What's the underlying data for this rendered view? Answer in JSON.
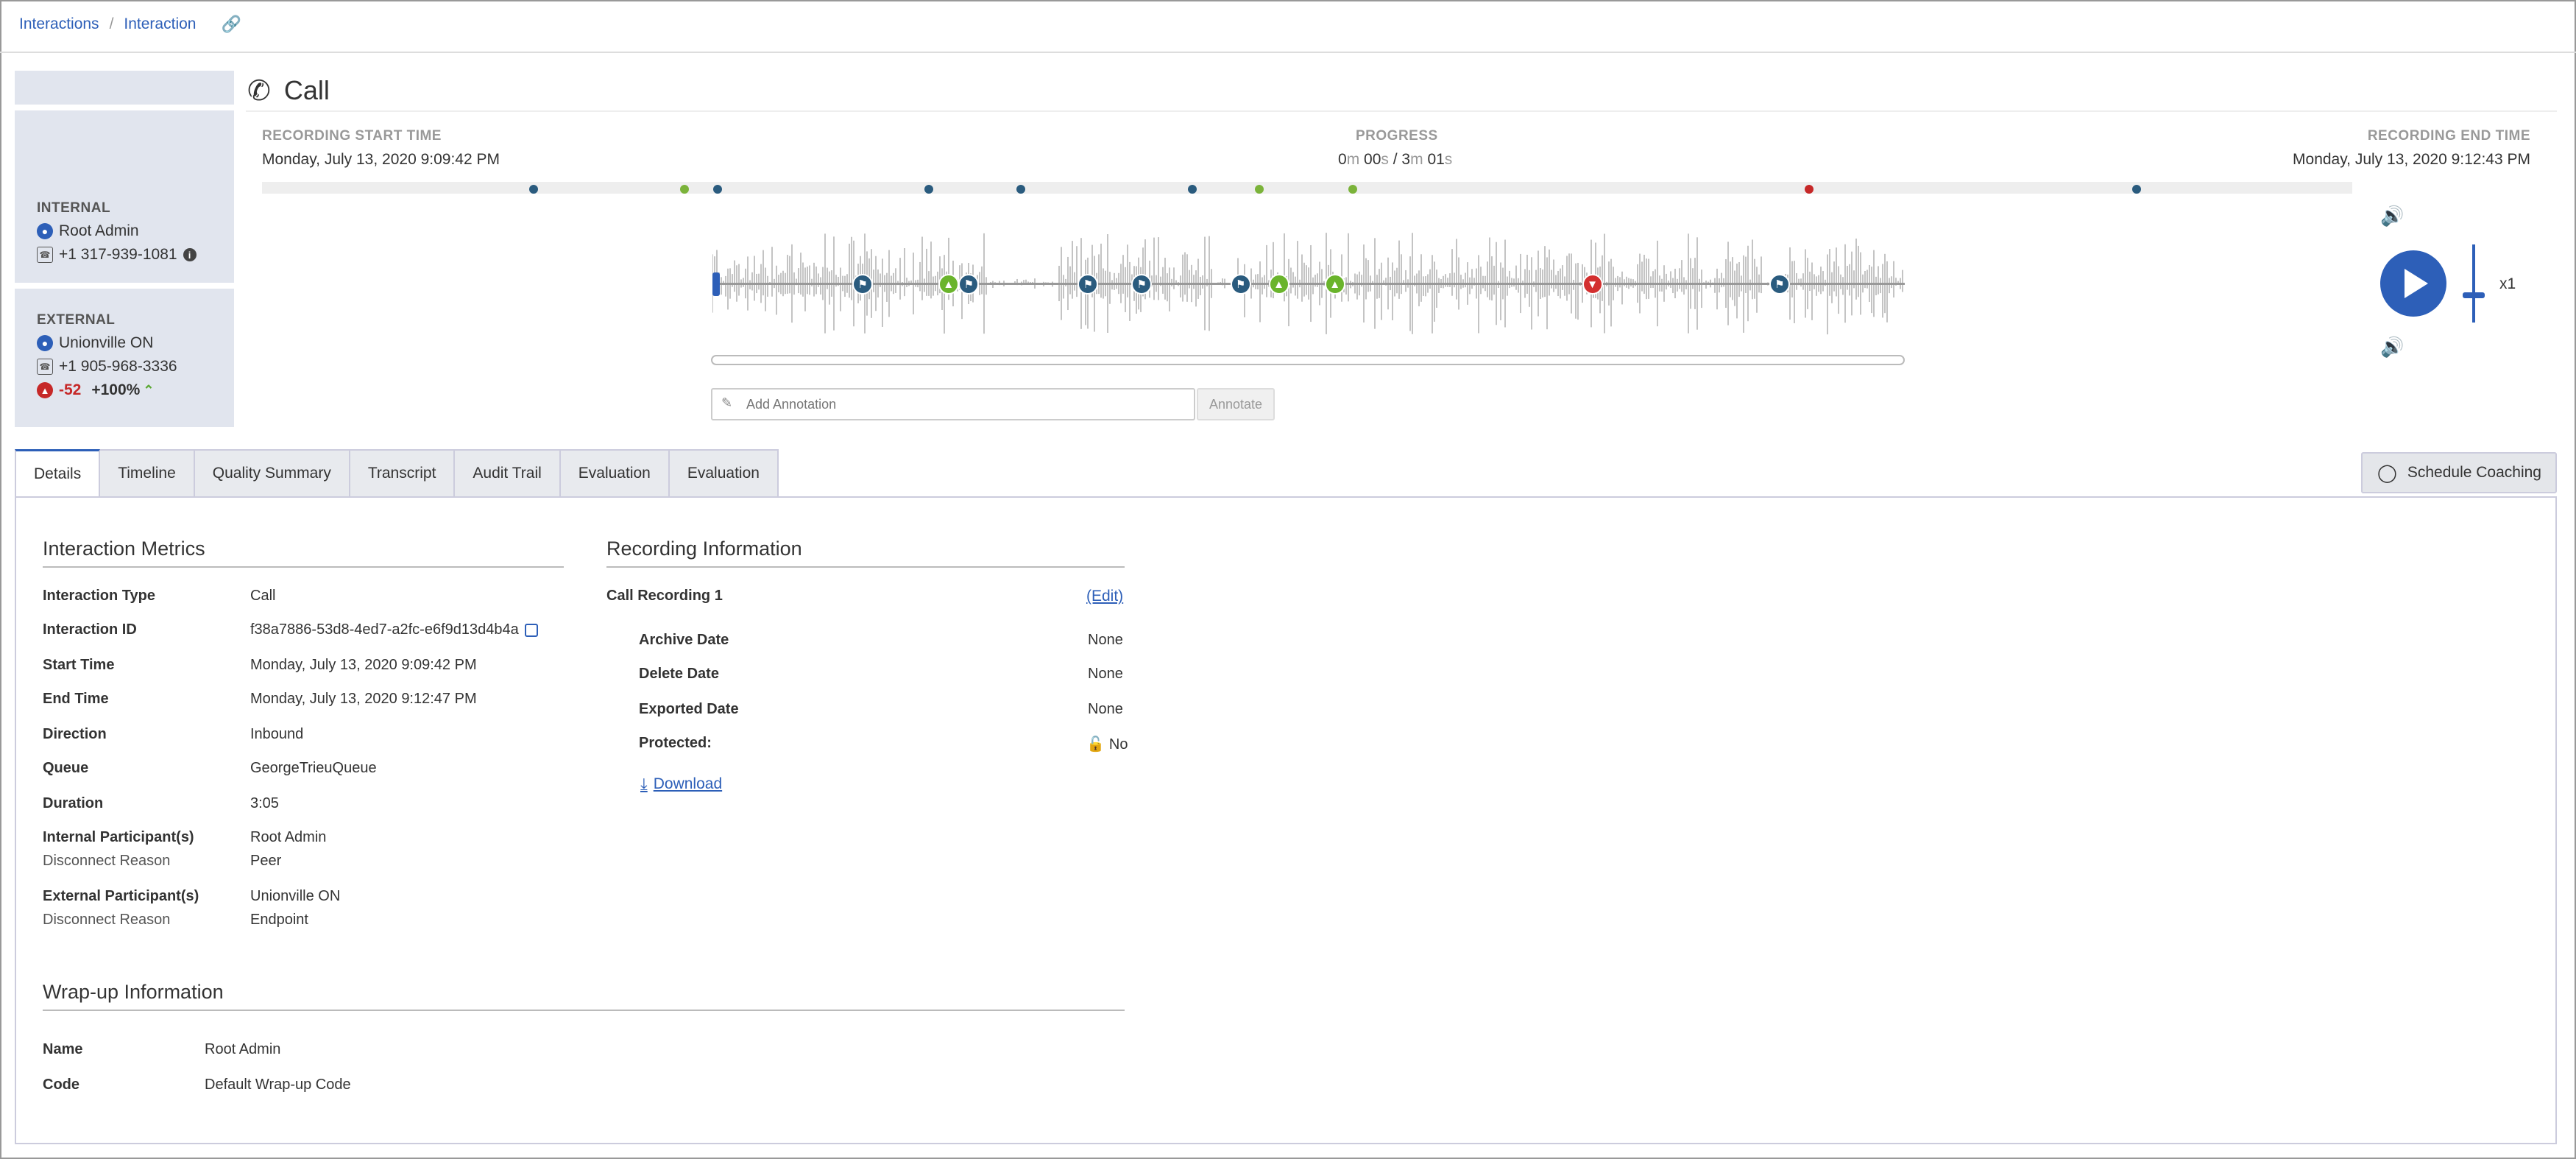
{
  "breadcrumb": {
    "items": [
      "Interactions",
      "Interaction"
    ],
    "separator": "/"
  },
  "header": {
    "title": "Call",
    "icon": "phone-icon"
  },
  "participants": {
    "internal": {
      "heading": "INTERNAL",
      "name": "Root Admin",
      "phone": "+1 317-939-1081"
    },
    "external": {
      "heading": "EXTERNAL",
      "name": "Unionville ON",
      "phone": "+1 905-968-3336",
      "sentiment_score": "-52",
      "sentiment_trend": "+100%"
    }
  },
  "recording": {
    "start_label": "RECORDING START TIME",
    "start_value": "Monday, July 13, 2020 9:09:42 PM",
    "progress_label": "PROGRESS",
    "progress": {
      "cur_m": "0",
      "cur_s": "00",
      "tot_m": "3",
      "tot_s": "01",
      "m_unit": "m",
      "s_unit": "s",
      "sep": " / "
    },
    "end_label": "RECORDING END TIME",
    "end_value": "Monday, July 13, 2020 9:12:43 PM",
    "timeline_events": [
      {
        "pos": 0.13,
        "type": "blue"
      },
      {
        "pos": 0.202,
        "type": "green"
      },
      {
        "pos": 0.218,
        "type": "blue"
      },
      {
        "pos": 0.319,
        "type": "blue"
      },
      {
        "pos": 0.363,
        "type": "blue"
      },
      {
        "pos": 0.445,
        "type": "blue"
      },
      {
        "pos": 0.477,
        "type": "green"
      },
      {
        "pos": 0.522,
        "type": "green"
      },
      {
        "pos": 0.74,
        "type": "red"
      },
      {
        "pos": 0.897,
        "type": "blue"
      }
    ],
    "waveform_markers": [
      {
        "pos": 0.126,
        "type": "blue",
        "icon": "bookmark-icon"
      },
      {
        "pos": 0.198,
        "type": "green",
        "icon": "thumbs-up-icon"
      },
      {
        "pos": 0.215,
        "type": "blue",
        "icon": "bookmark-icon"
      },
      {
        "pos": 0.315,
        "type": "blue",
        "icon": "bookmark-icon"
      },
      {
        "pos": 0.36,
        "type": "blue",
        "icon": "bookmark-icon"
      },
      {
        "pos": 0.443,
        "type": "blue",
        "icon": "bookmark-icon"
      },
      {
        "pos": 0.475,
        "type": "green",
        "icon": "thumbs-up-icon"
      },
      {
        "pos": 0.522,
        "type": "green",
        "icon": "thumbs-up-icon"
      },
      {
        "pos": 0.738,
        "type": "red",
        "icon": "thumbs-down-icon"
      },
      {
        "pos": 0.895,
        "type": "blue",
        "icon": "bookmark-icon"
      }
    ],
    "annotation_placeholder": "Add Annotation",
    "annotate_label": "Annotate",
    "speed": "x1"
  },
  "tabs": [
    "Details",
    "Timeline",
    "Quality Summary",
    "Transcript",
    "Audit Trail",
    "Evaluation",
    "Evaluation"
  ],
  "active_tab": 0,
  "schedule_coaching_label": "Schedule Coaching",
  "metrics": {
    "title": "Interaction Metrics",
    "rows": [
      {
        "k": "Interaction Type",
        "v": "Call"
      },
      {
        "k": "Interaction ID",
        "v": "f38a7886-53d8-4ed7-a2fc-e6f9d13d4b4a"
      },
      {
        "k": "Start Time",
        "v": "Monday, July 13, 2020 9:09:42 PM"
      },
      {
        "k": "End Time",
        "v": "Monday, July 13, 2020 9:12:47 PM"
      },
      {
        "k": "Direction",
        "v": "Inbound"
      },
      {
        "k": "Queue",
        "v": "GeorgeTrieuQueue"
      },
      {
        "k": "Duration",
        "v": "3:05"
      },
      {
        "k": "Internal Participant(s)",
        "v": "Root Admin",
        "sub_k": "Disconnect Reason",
        "sub_v": "Peer"
      },
      {
        "k": "External Participant(s)",
        "v": "Unionville ON",
        "sub_k": "Disconnect Reason",
        "sub_v": "Endpoint"
      }
    ]
  },
  "recording_info": {
    "title": "Recording Information",
    "name": "Call Recording 1",
    "edit_label": "(Edit)",
    "rows": [
      {
        "k": "Archive Date",
        "v": "None"
      },
      {
        "k": "Delete Date",
        "v": "None"
      },
      {
        "k": "Exported Date",
        "v": "None"
      },
      {
        "k": "Protected:",
        "v": "No"
      }
    ],
    "download_label": "Download"
  },
  "wrapup": {
    "title": "Wrap-up Information",
    "rows": [
      {
        "k": "Name",
        "v": "Root Admin"
      },
      {
        "k": "Code",
        "v": "Default Wrap-up Code"
      }
    ]
  },
  "colors": {
    "accent": "#2d5fb8",
    "positive": "#6ab42c",
    "negative": "#d32f2f",
    "bookmark": "#2a5b7e"
  }
}
